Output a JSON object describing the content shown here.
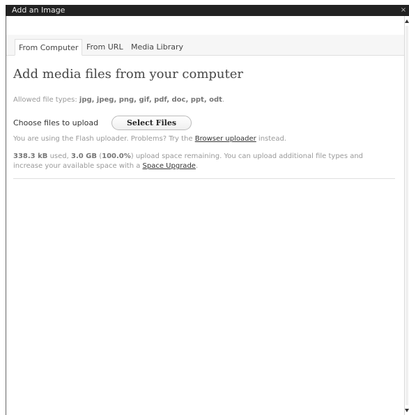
{
  "dialog": {
    "title": "Add an Image",
    "close_glyph": "×"
  },
  "tabs": [
    {
      "label": "From Computer",
      "active": true
    },
    {
      "label": "From URL",
      "active": false
    },
    {
      "label": "Media Library",
      "active": false
    }
  ],
  "main": {
    "heading": "Add media files from your computer",
    "allowed_prefix": "Allowed file types: ",
    "allowed_types": "jpg, jpeg, png, gif, pdf, doc, ppt, odt",
    "allowed_suffix": ".",
    "choose_label": "Choose files to upload",
    "select_button": "Select Files",
    "flash_text_before": "You are using the Flash uploader. Problems? Try the ",
    "flash_link": "Browser uploader",
    "flash_text_after": " instead.",
    "space_used": "338.3 kB",
    "space_used_suffix": " used, ",
    "space_total": "3.0 GB",
    "space_paren_open": " (",
    "space_percent": "100.0%",
    "space_text": ") upload space remaining. You can upload additional file types and increase your available space with a ",
    "space_link": "Space Upgrade",
    "space_end": "."
  },
  "colors": {
    "titlebar_bg": "#222222",
    "tab_strip_bg": "#f6f6f6",
    "muted_text": "#999999",
    "link_text": "#333333"
  },
  "icons": {
    "close": "close-icon",
    "scroll_up": "scroll-up-arrow-icon",
    "scroll_down": "scroll-down-arrow-icon"
  }
}
